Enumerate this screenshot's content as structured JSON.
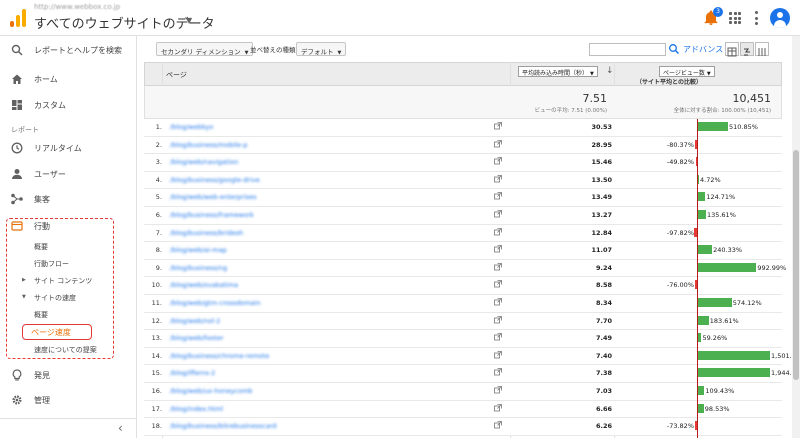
{
  "header": {
    "url": "http://www.webbox.co.jp",
    "title": "すべてのウェブサイトのデータ",
    "notification_count": "3",
    "accent_color": "#1a73e8"
  },
  "sidebar": {
    "search_label": "レポートとヘルプを検索",
    "home": "ホーム",
    "custom": "カスタム",
    "section_label": "レポート",
    "realtime": "リアルタイム",
    "users": "ユーザー",
    "acquisition": "集客",
    "behavior": "行動",
    "behavior_sub": {
      "overview": "概要",
      "behavior_flow": "行動フロー",
      "site_content": "サイト コンテンツ",
      "site_speed": "サイトの速度",
      "speed_overview": "概要",
      "page_timings": "ページ速度",
      "speed_suggestions": "速度についての提案"
    },
    "discover": "発見",
    "admin": "管理",
    "highlight_color": "#e53935"
  },
  "toolbar": {
    "secondary_dimension": "セカンダリ ディメンション",
    "sort_type_label": "並べ替えの種類:",
    "sort_type_value": "デフォルト",
    "search_placeholder": "",
    "advanced": "アドバンス"
  },
  "table": {
    "col_page": "ページ",
    "col_metric": "平均読み込み時間（秒）",
    "col_compare": "ページビュー数",
    "col_compare_sub": "（サイト平均との比較）",
    "summary_value": "7.51",
    "summary_sub": "ビューの平均: 7.51 (0.00%)",
    "summary_pv": "10,451",
    "summary_pv_sub": "全体に対する割合: 100.00% (10,451)",
    "rows": [
      {
        "num": "1.",
        "page": "/blog/webkyo",
        "value": "30.53",
        "pct": "510.85%",
        "pct_value": 510.85
      },
      {
        "num": "2.",
        "page": "/blog/business/mobile-p",
        "value": "28.95",
        "pct": "-80.37%",
        "pct_value": -80.37
      },
      {
        "num": "3.",
        "page": "/blog/web/navigation",
        "value": "15.46",
        "pct": "-49.82%",
        "pct_value": -49.82
      },
      {
        "num": "4.",
        "page": "/blog/business/google-drive",
        "value": "13.50",
        "pct": "4.72%",
        "pct_value": 4.72
      },
      {
        "num": "5.",
        "page": "/blog/web/web-enterprises",
        "value": "13.49",
        "pct": "124.71%",
        "pct_value": 124.71
      },
      {
        "num": "6.",
        "page": "/blog/business/framework",
        "value": "13.27",
        "pct": "135.61%",
        "pct_value": 135.61
      },
      {
        "num": "7.",
        "page": "/blog/business/bridesh",
        "value": "12.84",
        "pct": "-97.82%",
        "pct_value": -97.82
      },
      {
        "num": "8.",
        "page": "/blog/web/ai-map",
        "value": "11.07",
        "pct": "240.33%",
        "pct_value": 240.33
      },
      {
        "num": "9.",
        "page": "/blog/business/ng",
        "value": "9.24",
        "pct": "992.99%",
        "pct_value": 992.99
      },
      {
        "num": "10.",
        "page": "/blog/web/ovakatima",
        "value": "8.58",
        "pct": "-76.00%",
        "pct_value": -76.0
      },
      {
        "num": "11.",
        "page": "/blog/web/gtm-crossdomain",
        "value": "8.34",
        "pct": "574.12%",
        "pct_value": 574.12
      },
      {
        "num": "12.",
        "page": "/blog/web/nol-2",
        "value": "7.70",
        "pct": "183.61%",
        "pct_value": 183.61
      },
      {
        "num": "13.",
        "page": "/blog/web/footer",
        "value": "7.49",
        "pct": "59.26%",
        "pct_value": 59.26
      },
      {
        "num": "14.",
        "page": "/blog/business/chrome-remote",
        "value": "7.40",
        "pct": "1,501.30%",
        "pct_value": 1501.3
      },
      {
        "num": "15.",
        "page": "/blog/ifferns-2",
        "value": "7.38",
        "pct": "1,944.17%",
        "pct_value": 1944.17
      },
      {
        "num": "16.",
        "page": "/blog/web/ux-honeycomb",
        "value": "7.03",
        "pct": "109.43%",
        "pct_value": 109.43
      },
      {
        "num": "17.",
        "page": "/blog/index.html",
        "value": "6.66",
        "pct": "98.53%",
        "pct_value": 98.53
      },
      {
        "num": "18.",
        "page": "/blog/business/bitrebusinesscard",
        "value": "6.26",
        "pct": "-73.82%",
        "pct_value": -73.82
      }
    ]
  }
}
